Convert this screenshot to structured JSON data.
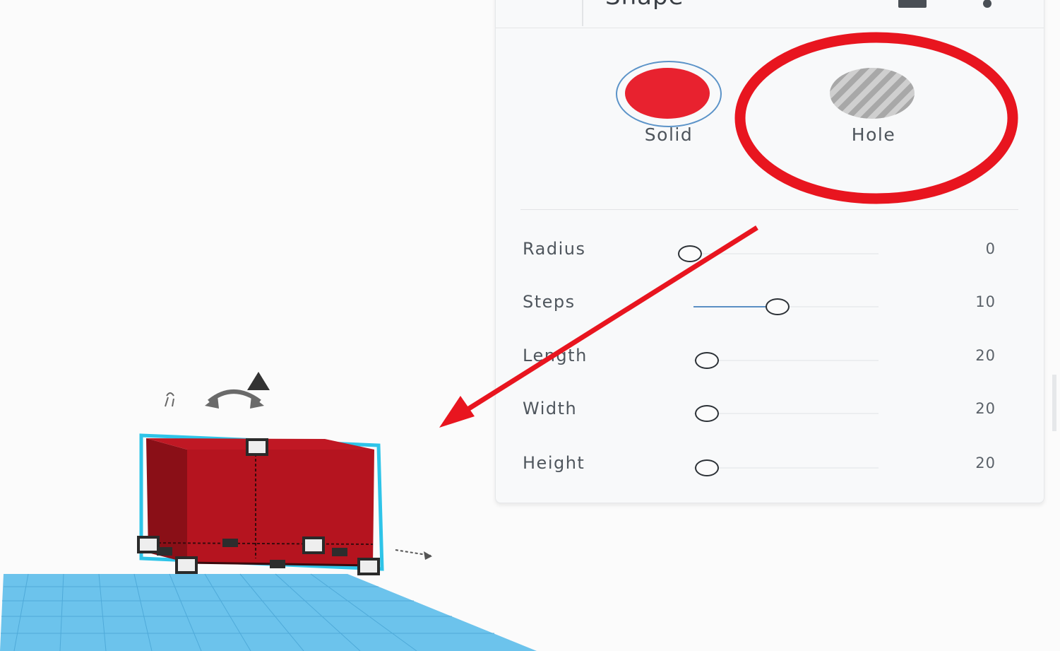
{
  "panel": {
    "header": {
      "title": "Shape"
    },
    "types": [
      {
        "label": "Solid",
        "color": "#e8222f"
      },
      {
        "label": "Hole",
        "color": "#b8b8b8"
      }
    ],
    "params": [
      {
        "label": "Radius",
        "value": "0",
        "fraction": 0.0
      },
      {
        "label": "Steps",
        "value": "10",
        "fraction": 0.45
      },
      {
        "label": "Length",
        "value": "20",
        "fraction": 0.0
      },
      {
        "label": "Width",
        "value": "20",
        "fraction": 0.0
      },
      {
        "label": "Height",
        "value": "20",
        "fraction": 0.0
      }
    ]
  },
  "colors": {
    "cube_front": "#b5141f",
    "cube_side": "#8a0f17",
    "selection_outline": "#2ec4e8",
    "workplane": "#6cc3ec",
    "annotation": "#e8151f",
    "slider_fill": "#5a8fc3"
  },
  "icons": [
    "rotate-arrow-icon",
    "lift-arrow-icon",
    "ruler-icon",
    "nudge-arrow-icon"
  ]
}
